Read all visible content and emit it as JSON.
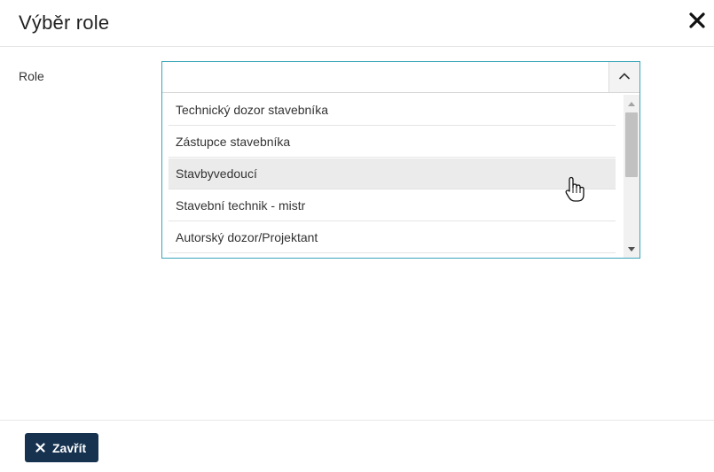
{
  "dialog": {
    "title": "Výběr role",
    "close_icon": "close-icon"
  },
  "form": {
    "role_label": "Role",
    "role_value": "",
    "toggle_icon": "chevron-up-icon",
    "options": [
      "Technický dozor stavebníka",
      "Zástupce stavebníka",
      "Stavbyvedoucí",
      "Stavební technik - mistr",
      "Autorský dozor/Projektant"
    ],
    "hovered_option": "Stavbyvedoucí"
  },
  "footer": {
    "close_button_label": "Zavřít",
    "close_button_icon": "close-icon",
    "button_color": "#16324f"
  },
  "colors": {
    "accent_border": "#3aa6b9",
    "hover_bg": "#ebebeb"
  }
}
